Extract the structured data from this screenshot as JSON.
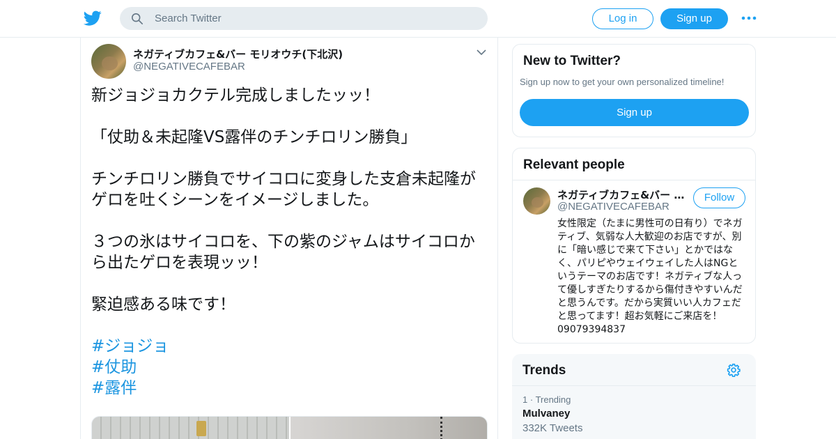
{
  "header": {
    "search_placeholder": "Search Twitter",
    "login_label": "Log in",
    "signup_label": "Sign up",
    "logo_icon": "twitter-bird-icon",
    "search_icon": "search-icon",
    "more_icon": "more-dots-icon",
    "accent_color": "#1da1f2"
  },
  "tweet": {
    "author_name": "ネガティブカフェ&バー モリオウチ(下北沢)",
    "author_handle": "@NEGATIVECAFEBAR",
    "lines": [
      "新ジョジョカクテル完成しましたッッ！",
      "",
      "「仗助＆未起隆VS露伴のチンチロリン勝負」",
      "",
      "チンチロリン勝負でサイコロに変身した支倉未起隆がゲロを吐くシーンをイメージしました。",
      "",
      "３つの氷はサイコロを、下の紫のジャムはサイコロから出たゲロを表現ッッ！",
      "",
      "緊迫感ある味です！",
      ""
    ],
    "hashtags": [
      "#ジョジョ",
      "#仗助",
      "#露伴"
    ],
    "hashtag_color": "#1b95e0"
  },
  "new_to_twitter": {
    "title": "New to Twitter?",
    "subtitle": "Sign up now to get your own personalized timeline!",
    "signup_label": "Sign up"
  },
  "relevant_people": {
    "title": "Relevant people",
    "person": {
      "name": "ネガティブカフェ&バー モリオウチ(下北沢)",
      "handle": "@NEGATIVECAFEBAR",
      "follow_label": "Follow",
      "bio": "女性限定（たまに男性可の日有り）でネガティブ、気弱な人大歓迎のお店ですが、別に「暗い感じで来て下さい」とかではなく、パリピやウェイウェイした人はNGというテーマのお店です！ネガティブな人って優しすぎたりするから傷付きやすいんだと思うんです。だから実質いい人カフェだと思ってます！超お気軽にご来店を！09079394837"
    }
  },
  "trends": {
    "title": "Trends",
    "settings_icon": "gear-icon",
    "items": [
      {
        "rank": "1",
        "context": "Trending",
        "name": "Mulvaney",
        "count": "332K Tweets"
      }
    ]
  }
}
